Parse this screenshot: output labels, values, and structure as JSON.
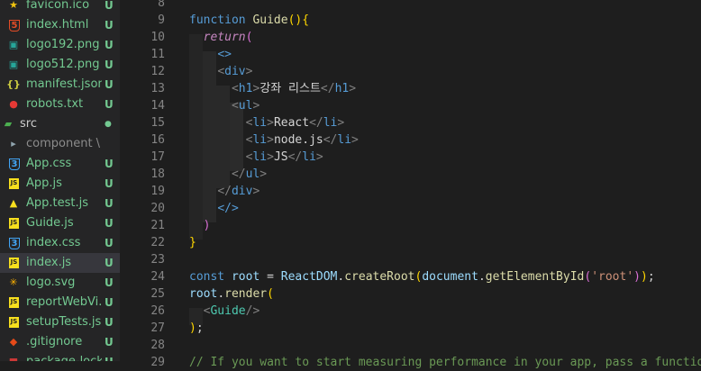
{
  "explorer": {
    "files": [
      {
        "name": "favicon.ico",
        "badge": "U",
        "icon": "star-icon",
        "color": "#f1c40f",
        "glyph": "★",
        "status": "untracked"
      },
      {
        "name": "index.html",
        "badge": "U",
        "icon": "html5-icon",
        "color": "#e34c26",
        "glyph": "5",
        "status": "untracked"
      },
      {
        "name": "logo192.png",
        "badge": "U",
        "icon": "image-icon",
        "color": "#26a69a",
        "glyph": "▣",
        "status": "untracked"
      },
      {
        "name": "logo512.png",
        "badge": "U",
        "icon": "image-icon",
        "color": "#26a69a",
        "glyph": "▣",
        "status": "untracked"
      },
      {
        "name": "manifest.json",
        "badge": "U",
        "icon": "json-icon",
        "color": "#cbcb41",
        "glyph": "{}",
        "status": "untracked"
      },
      {
        "name": "robots.txt",
        "badge": "U",
        "icon": "robot-icon",
        "color": "#e53935",
        "glyph": "●",
        "status": "untracked"
      },
      {
        "name": "src",
        "badge": "●",
        "icon": "folder-src-icon",
        "color": "#4caf50",
        "glyph": "▰",
        "status": "folder"
      },
      {
        "name": "component \\ Books",
        "badge": "",
        "icon": "folder-icon",
        "color": "#90a4ae",
        "glyph": "▸",
        "status": "dim"
      },
      {
        "name": "App.css",
        "badge": "U",
        "icon": "css3-icon",
        "color": "#42a5f5",
        "glyph": "3",
        "status": "untracked"
      },
      {
        "name": "App.js",
        "badge": "U",
        "icon": "javascript-icon",
        "color": "#f7df1e",
        "glyph": "JS",
        "status": "untracked"
      },
      {
        "name": "App.test.js",
        "badge": "U",
        "icon": "test-js-icon",
        "color": "#f7df1e",
        "glyph": "▲",
        "status": "untracked"
      },
      {
        "name": "Guide.js",
        "badge": "U",
        "icon": "javascript-icon",
        "color": "#f7df1e",
        "glyph": "JS",
        "status": "untracked"
      },
      {
        "name": "index.css",
        "badge": "U",
        "icon": "css3-icon",
        "color": "#42a5f5",
        "glyph": "3",
        "status": "untracked"
      },
      {
        "name": "index.js",
        "badge": "U",
        "icon": "javascript-icon",
        "color": "#f7df1e",
        "glyph": "JS",
        "status": "untracked"
      },
      {
        "name": "logo.svg",
        "badge": "U",
        "icon": "svg-icon",
        "color": "#ffb300",
        "glyph": "✳",
        "status": "untracked"
      },
      {
        "name": "reportWebVi...",
        "badge": "U",
        "icon": "javascript-icon",
        "color": "#f7df1e",
        "glyph": "JS",
        "status": "untracked"
      },
      {
        "name": "setupTests.js",
        "badge": "U",
        "icon": "javascript-icon",
        "color": "#f7df1e",
        "glyph": "JS",
        "status": "untracked"
      },
      {
        "name": ".gitignore",
        "badge": "U",
        "icon": "git-icon",
        "color": "#e64a19",
        "glyph": "◆",
        "status": "untracked"
      },
      {
        "name": "package-lock...",
        "badge": "U",
        "icon": "npm-icon",
        "color": "#cb3837",
        "glyph": "■",
        "status": "untracked"
      }
    ],
    "active_index": 13
  },
  "editor": {
    "line_numbers": [
      "8",
      "9",
      "10",
      "11",
      "12",
      "13",
      "14",
      "15",
      "16",
      "17",
      "18",
      "19",
      "20",
      "21",
      "22",
      "23",
      "24",
      "25",
      "26",
      "27",
      "28",
      "29"
    ],
    "lines": [
      {
        "tokens": []
      },
      {
        "tokens": [
          {
            "t": "function ",
            "c": "k-blue"
          },
          {
            "t": "Guide",
            "c": "k-yellow"
          },
          {
            "t": "(){",
            "c": "k-br1"
          }
        ]
      },
      {
        "tokens": [
          {
            "t": "  "
          },
          {
            "t": "return",
            "c": "k-purple"
          },
          {
            "t": "(",
            "c": "k-br2"
          }
        ]
      },
      {
        "tokens": [
          {
            "t": "    "
          },
          {
            "t": "<>",
            "c": "k-tag"
          }
        ]
      },
      {
        "tokens": [
          {
            "t": "    "
          },
          {
            "t": "<",
            "c": "k-punc"
          },
          {
            "t": "div",
            "c": "k-tag"
          },
          {
            "t": ">",
            "c": "k-punc"
          }
        ]
      },
      {
        "tokens": [
          {
            "t": "      "
          },
          {
            "t": "<",
            "c": "k-punc"
          },
          {
            "t": "h1",
            "c": "k-tag"
          },
          {
            "t": ">",
            "c": "k-punc"
          },
          {
            "t": "강좌 리스트",
            "c": "k-white"
          },
          {
            "t": "</",
            "c": "k-punc"
          },
          {
            "t": "h1",
            "c": "k-tag"
          },
          {
            "t": ">",
            "c": "k-punc"
          }
        ]
      },
      {
        "tokens": [
          {
            "t": "      "
          },
          {
            "t": "<",
            "c": "k-punc"
          },
          {
            "t": "ul",
            "c": "k-tag"
          },
          {
            "t": ">",
            "c": "k-punc"
          }
        ]
      },
      {
        "tokens": [
          {
            "t": "        "
          },
          {
            "t": "<",
            "c": "k-punc"
          },
          {
            "t": "li",
            "c": "k-tag"
          },
          {
            "t": ">",
            "c": "k-punc"
          },
          {
            "t": "React",
            "c": "k-white"
          },
          {
            "t": "</",
            "c": "k-punc"
          },
          {
            "t": "li",
            "c": "k-tag"
          },
          {
            "t": ">",
            "c": "k-punc"
          }
        ]
      },
      {
        "tokens": [
          {
            "t": "        "
          },
          {
            "t": "<",
            "c": "k-punc"
          },
          {
            "t": "li",
            "c": "k-tag"
          },
          {
            "t": ">",
            "c": "k-punc"
          },
          {
            "t": "node.js",
            "c": "k-white"
          },
          {
            "t": "</",
            "c": "k-punc"
          },
          {
            "t": "li",
            "c": "k-tag"
          },
          {
            "t": ">",
            "c": "k-punc"
          }
        ]
      },
      {
        "tokens": [
          {
            "t": "        "
          },
          {
            "t": "<",
            "c": "k-punc"
          },
          {
            "t": "li",
            "c": "k-tag"
          },
          {
            "t": ">",
            "c": "k-punc"
          },
          {
            "t": "JS",
            "c": "k-white"
          },
          {
            "t": "</",
            "c": "k-punc"
          },
          {
            "t": "li",
            "c": "k-tag"
          },
          {
            "t": ">",
            "c": "k-punc"
          }
        ]
      },
      {
        "tokens": [
          {
            "t": "      "
          },
          {
            "t": "</",
            "c": "k-punc"
          },
          {
            "t": "ul",
            "c": "k-tag"
          },
          {
            "t": ">",
            "c": "k-punc"
          }
        ]
      },
      {
        "tokens": [
          {
            "t": "    "
          },
          {
            "t": "</",
            "c": "k-punc"
          },
          {
            "t": "div",
            "c": "k-tag"
          },
          {
            "t": ">",
            "c": "k-punc"
          }
        ]
      },
      {
        "tokens": [
          {
            "t": "    "
          },
          {
            "t": "</>",
            "c": "k-tag"
          }
        ]
      },
      {
        "tokens": [
          {
            "t": "  "
          },
          {
            "t": ")",
            "c": "k-br2"
          }
        ]
      },
      {
        "tokens": [
          {
            "t": "}",
            "c": "k-br1"
          }
        ]
      },
      {
        "tokens": []
      },
      {
        "tokens": [
          {
            "t": "const ",
            "c": "k-blue"
          },
          {
            "t": "root",
            "c": "k-var"
          },
          {
            "t": " = ",
            "c": "k-white"
          },
          {
            "t": "ReactDOM",
            "c": "k-var"
          },
          {
            "t": ".",
            "c": "k-white"
          },
          {
            "t": "createRoot",
            "c": "k-yellow"
          },
          {
            "t": "(",
            "c": "k-br1"
          },
          {
            "t": "document",
            "c": "k-var"
          },
          {
            "t": ".",
            "c": "k-white"
          },
          {
            "t": "getElementById",
            "c": "k-yellow"
          },
          {
            "t": "(",
            "c": "k-br2"
          },
          {
            "t": "'root'",
            "c": "k-str"
          },
          {
            "t": ")",
            "c": "k-br2"
          },
          {
            "t": ")",
            "c": "k-br1"
          },
          {
            "t": ";",
            "c": "k-white"
          }
        ]
      },
      {
        "tokens": [
          {
            "t": "root",
            "c": "k-var"
          },
          {
            "t": ".",
            "c": "k-white"
          },
          {
            "t": "render",
            "c": "k-yellow"
          },
          {
            "t": "(",
            "c": "k-br1"
          }
        ]
      },
      {
        "tokens": [
          {
            "t": "  "
          },
          {
            "t": "<",
            "c": "k-punc"
          },
          {
            "t": "Guide",
            "c": "k-cls"
          },
          {
            "t": "/>",
            "c": "k-punc"
          }
        ]
      },
      {
        "tokens": [
          {
            "t": ")",
            "c": "k-br1"
          },
          {
            "t": ";",
            "c": "k-white"
          }
        ]
      },
      {
        "tokens": []
      },
      {
        "tokens": [
          {
            "t": "// If you want to start measuring performance in your app, pass a function",
            "c": "k-com"
          }
        ]
      }
    ]
  }
}
